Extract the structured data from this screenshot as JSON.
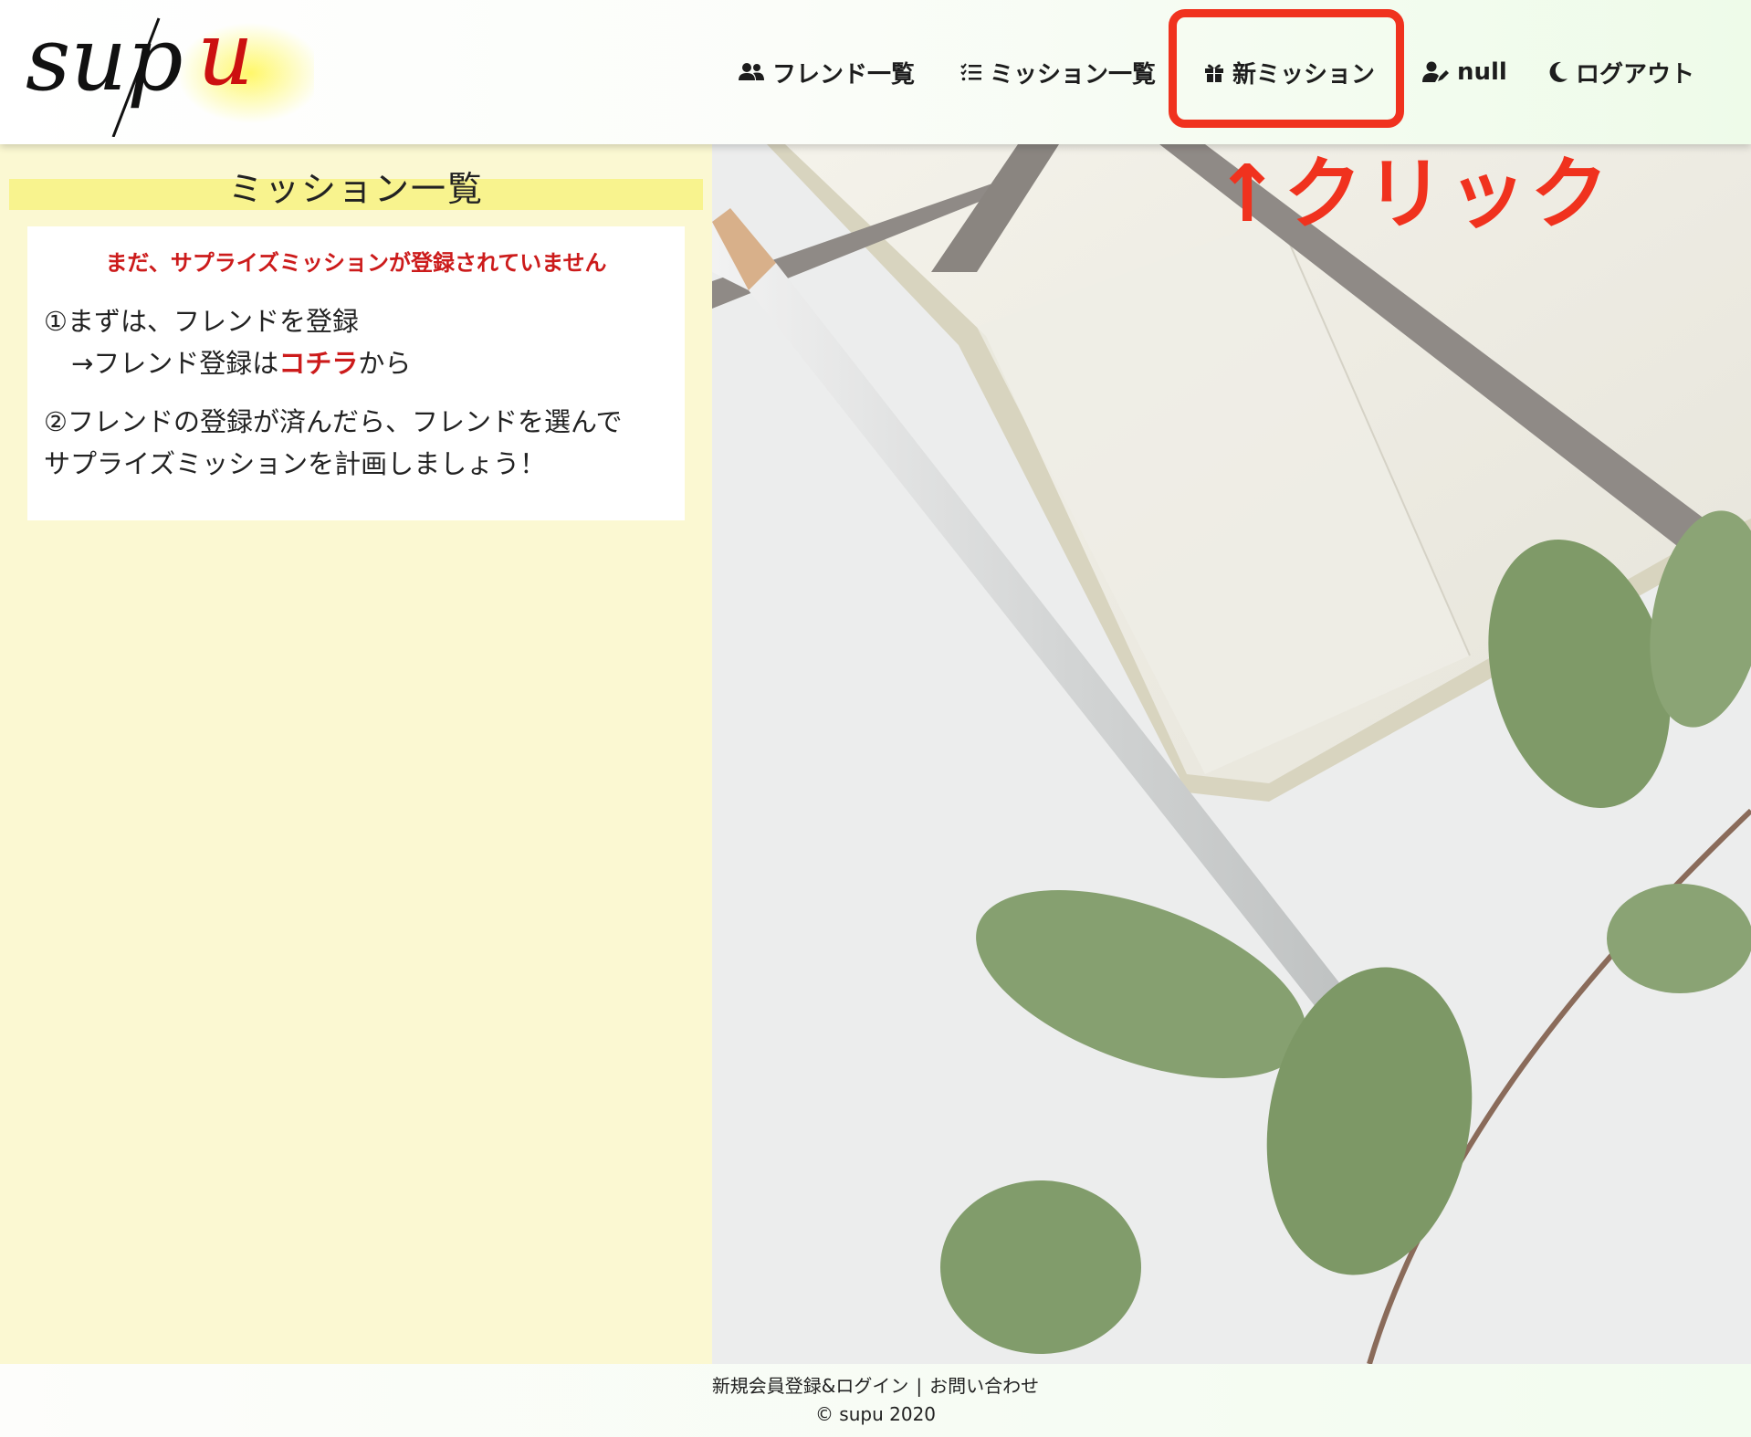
{
  "header": {
    "logo_text": "supu",
    "nav": [
      {
        "label": "フレンド一覧",
        "icon": "users-icon"
      },
      {
        "label": "ミッション一覧",
        "icon": "list-check-icon"
      },
      {
        "label": "新ミッション",
        "icon": "gift-icon"
      },
      {
        "label": "null",
        "icon": "user-edit-icon"
      },
      {
        "label": "ログアウト",
        "icon": "moon-icon"
      }
    ]
  },
  "annotation": {
    "click_hint": "↑クリック",
    "highlight_color": "#f0321e"
  },
  "main": {
    "section_title": "ミッション一覧",
    "warning": "まだ、サプライズミッションが登録されていません",
    "step1_line1": "①まずは、フレンドを登録",
    "step1_line2_prefix": "→フレンド登録は",
    "step1_link": "コチラ",
    "step1_line2_suffix": "から",
    "step2_line1": "②フレンドの登録が済んだら、フレンドを選んで",
    "step2_line2": "サプライズミッションを計画しましょう！"
  },
  "footer": {
    "register_link": "新規会員登録&ログイン",
    "separator": "|",
    "contact_link": "お問い合わせ",
    "copyright": "© supu 2020"
  },
  "colors": {
    "accent_red": "#cc1b1b",
    "panel_bg": "#fbf8d2",
    "title_bar": "#f8f28a"
  }
}
